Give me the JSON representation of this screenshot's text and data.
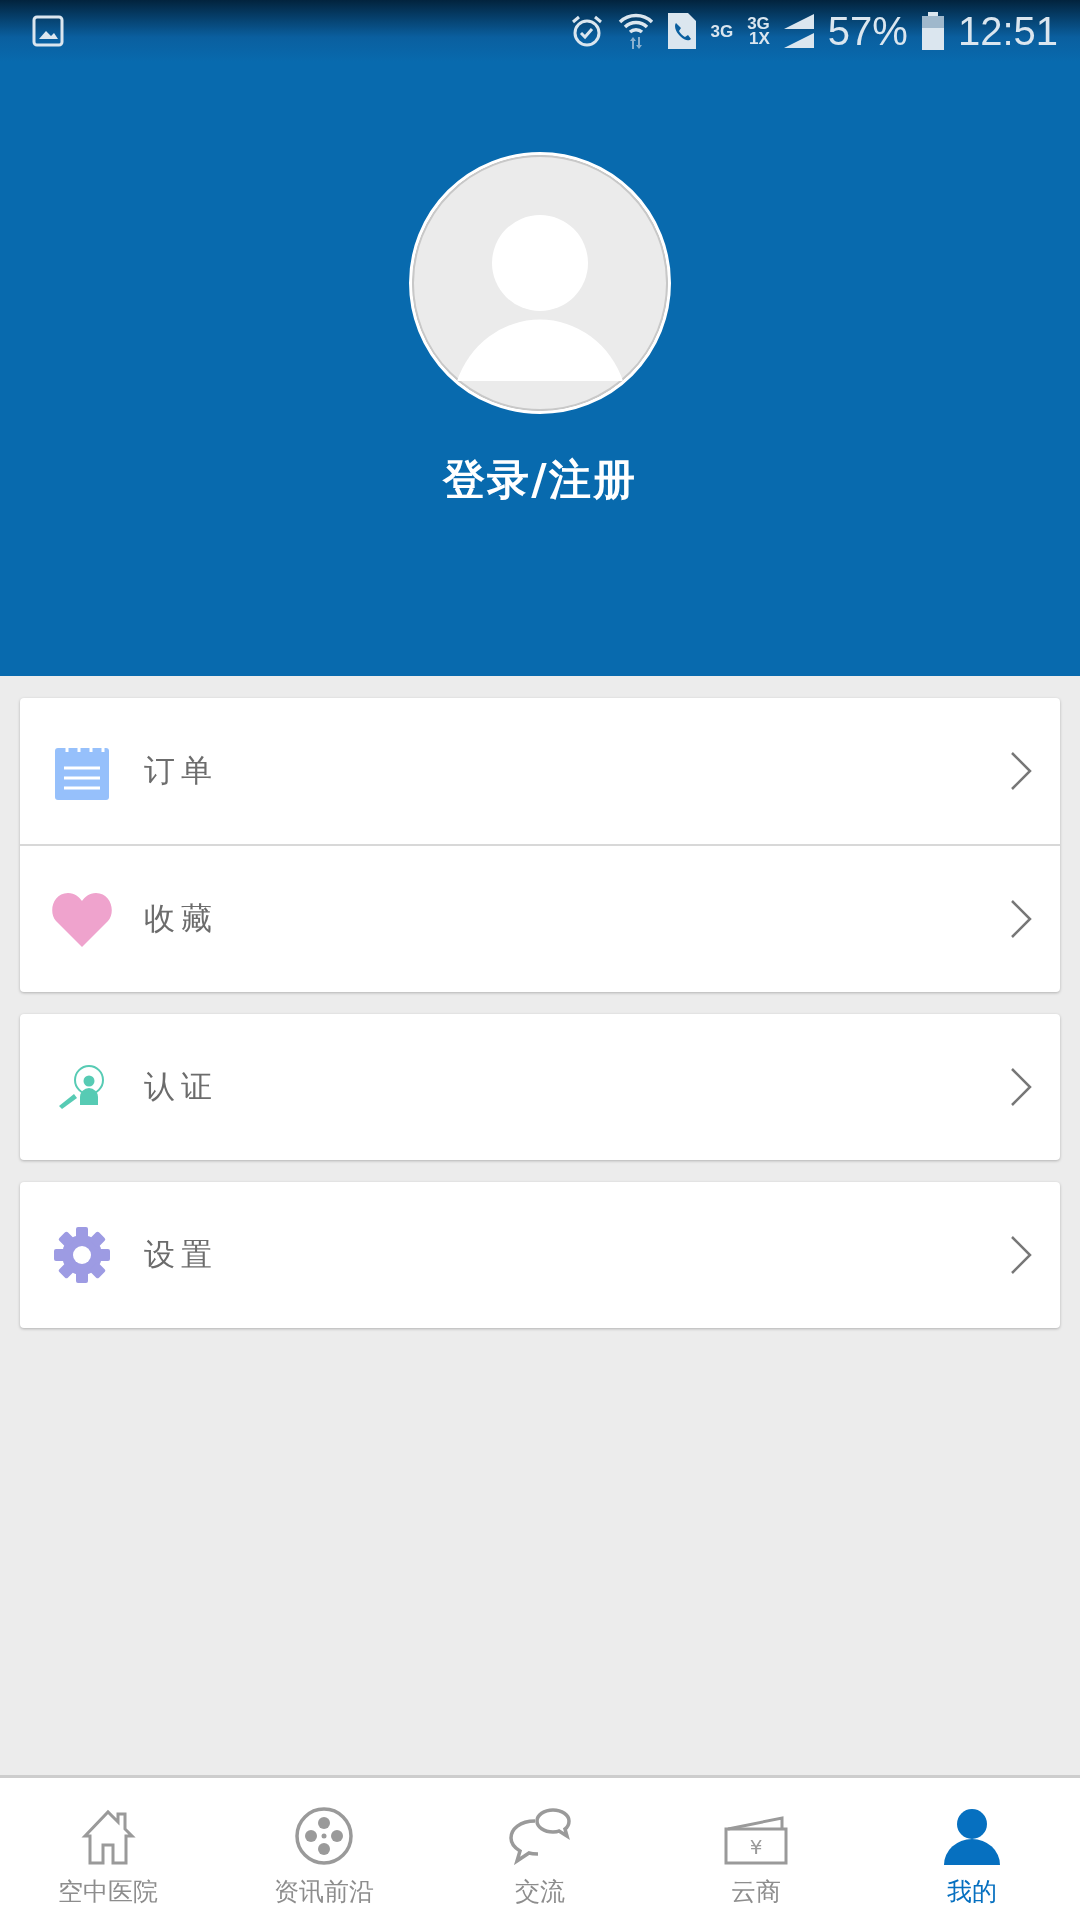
{
  "status_bar": {
    "network_1": "3G",
    "network_2": "3G",
    "network_3": "1X",
    "battery": "57%",
    "time": "12:51"
  },
  "profile": {
    "login_label": "登录/注册"
  },
  "menu_groups": [
    [
      {
        "label": "订单",
        "kind": "notepad"
      },
      {
        "label": "收藏",
        "kind": "heart"
      }
    ],
    [
      {
        "label": "认证",
        "kind": "verify"
      }
    ],
    [
      {
        "label": "设置",
        "kind": "gear"
      }
    ]
  ],
  "tab_bar": [
    {
      "label": "空中医院",
      "kind": "house",
      "selected": false
    },
    {
      "label": "资讯前沿",
      "kind": "reel",
      "selected": false
    },
    {
      "label": "交流",
      "kind": "chat",
      "selected": false
    },
    {
      "label": "云商",
      "kind": "wallet",
      "symbol": "¥",
      "selected": false
    },
    {
      "label": "我的",
      "kind": "person",
      "selected": true
    }
  ]
}
